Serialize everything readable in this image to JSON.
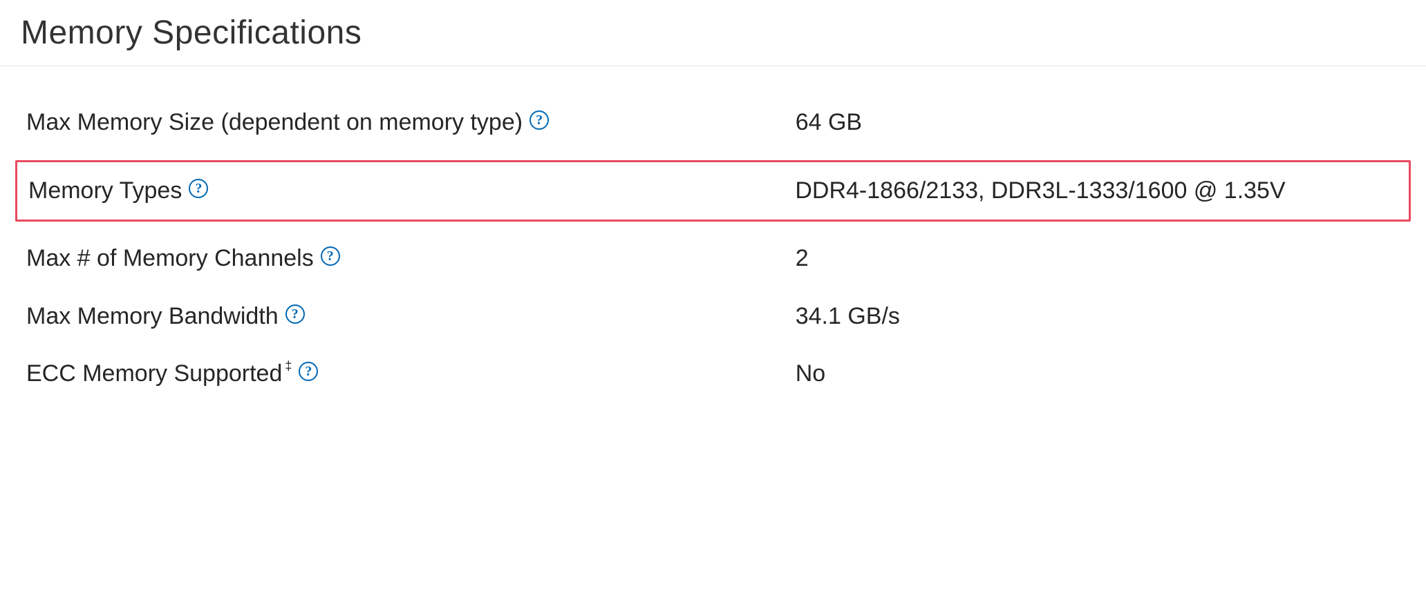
{
  "section": {
    "title": "Memory Specifications"
  },
  "help_glyph": "?",
  "footnote_glyph": "‡",
  "specs": [
    {
      "label": "Max Memory Size (dependent on memory type)",
      "value": "64 GB",
      "has_help": true,
      "has_footnote": false,
      "highlighted": false
    },
    {
      "label": "Memory Types",
      "value": "DDR4-1866/2133, DDR3L-1333/1600 @ 1.35V",
      "has_help": true,
      "has_footnote": false,
      "highlighted": true
    },
    {
      "label": "Max # of Memory Channels",
      "value": "2",
      "has_help": true,
      "has_footnote": false,
      "highlighted": false
    },
    {
      "label": "Max Memory Bandwidth",
      "value": "34.1 GB/s",
      "has_help": true,
      "has_footnote": false,
      "highlighted": false
    },
    {
      "label": "ECC Memory Supported",
      "value": "No",
      "has_help": true,
      "has_footnote": true,
      "highlighted": false
    }
  ]
}
